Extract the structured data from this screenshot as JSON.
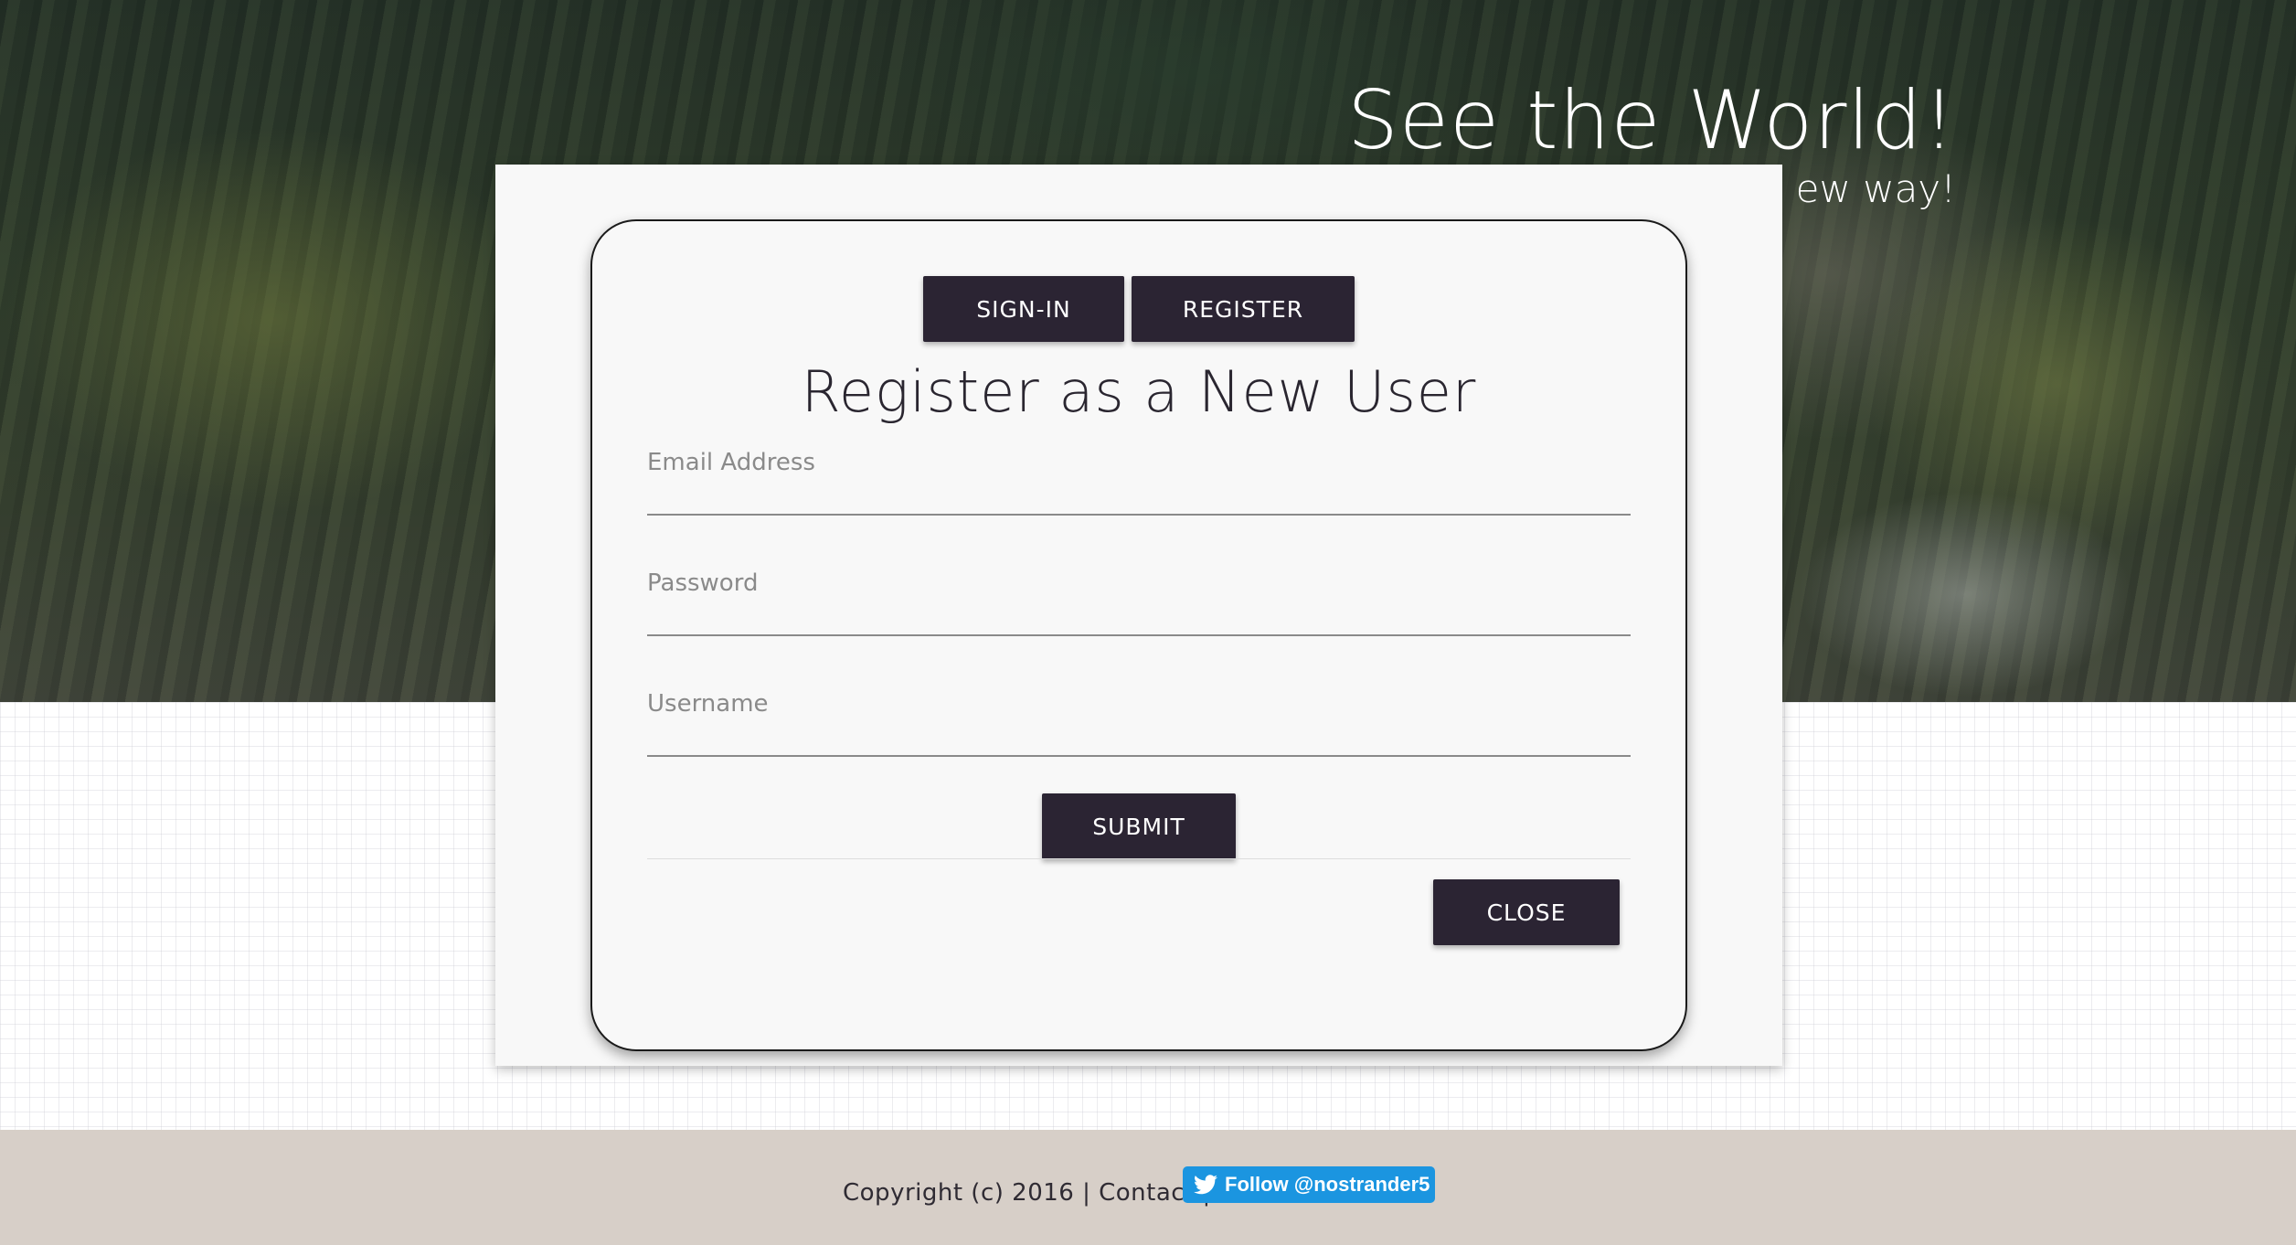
{
  "hero": {
    "title": "See the World!",
    "subtitle": "ew way!"
  },
  "modal": {
    "tabs": [
      {
        "label": "SIGN-IN"
      },
      {
        "label": "REGISTER"
      }
    ],
    "heading": "Register as a New User",
    "fields": {
      "email": {
        "placeholder": "Email Address",
        "value": ""
      },
      "password": {
        "placeholder": "Password",
        "value": ""
      },
      "username": {
        "placeholder": "Username",
        "value": ""
      }
    },
    "submit_label": "SUBMIT",
    "close_label": "CLOSE"
  },
  "footer": {
    "text": "Copyright (c) 2016 | Contact |",
    "twitter_label": "Follow @nostrander5"
  },
  "colors": {
    "button_bg": "#2b2433",
    "footer_bg": "#d7cfc8",
    "twitter_blue": "#1b95e0"
  },
  "icons": {
    "twitter": "twitter-bird-icon"
  }
}
